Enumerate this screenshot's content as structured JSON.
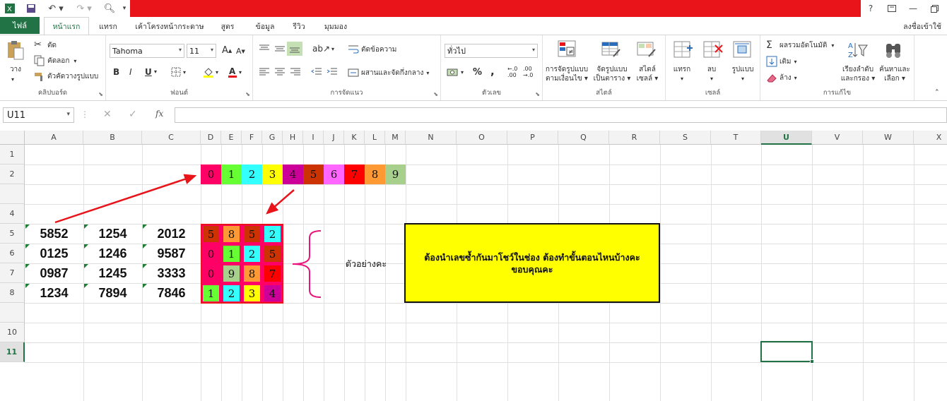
{
  "app": {
    "title": ""
  },
  "tabs": {
    "file": "ไฟล์",
    "items": [
      "หน้าแรก",
      "แทรก",
      "เค้าโครงหน้ากระดาษ",
      "สูตร",
      "ข้อมูล",
      "รีวิว",
      "มุมมอง"
    ],
    "active": "หน้าแรก",
    "signin": "ลงชื่อเข้าใช้"
  },
  "window_controls": {
    "help": "?"
  },
  "ribbon": {
    "clipboard": {
      "label": "คลิปบอร์ด",
      "paste": "วาง",
      "cut": "ตัด",
      "copy": "คัดลอก",
      "format_painter": "ตัวคัดวางรูปแบบ"
    },
    "font": {
      "label": "ฟอนต์",
      "font_name": "Tahoma",
      "font_size": "11",
      "bold": "B",
      "italic": "I",
      "underline": "U"
    },
    "alignment": {
      "label": "การจัดแนว",
      "wrap_text": "ตัดข้อความ",
      "merge_center": "ผสานและจัดกึ่งกลาง"
    },
    "number": {
      "label": "ตัวเลข",
      "format": "ทั่วไป",
      "percent": "%",
      "comma": ","
    },
    "styles": {
      "label": "สไตล์",
      "conditional_1": "การจัดรูปแบบ",
      "conditional_2": "ตามเงื่อนไข",
      "format_table_1": "จัดรูปแบบ",
      "format_table_2": "เป็นตาราง",
      "cell_styles_1": "สไตล์",
      "cell_styles_2": "เซลล์"
    },
    "cells": {
      "label": "เซลล์",
      "insert": "แทรก",
      "delete": "ลบ",
      "format": "รูปแบบ"
    },
    "editing": {
      "label": "การแก้ไข",
      "autosum": "ผลรวมอัตโนมัติ",
      "fill": "เติม",
      "clear": "ล้าง",
      "sort_1": "เรียงลำดับ",
      "sort_2": "และกรอง",
      "find_1": "ค้นหาและ",
      "find_2": "เลือก"
    }
  },
  "formula_bar": {
    "name_box": "U11",
    "fx": "fx",
    "value": ""
  },
  "sheet": {
    "columns": [
      "A",
      "B",
      "C",
      "D",
      "E",
      "F",
      "G",
      "H",
      "I",
      "J",
      "K",
      "L",
      "M",
      "N",
      "O",
      "P",
      "Q",
      "R",
      "S",
      "T",
      "U",
      "V",
      "W",
      "X"
    ],
    "rows": [
      "1",
      "2",
      "4",
      "5",
      "6",
      "7",
      "8",
      "10",
      "11"
    ],
    "selected_column": "U",
    "selected_row": "11",
    "digit_header": [
      "0",
      "1",
      "2",
      "3",
      "4",
      "5",
      "6",
      "7",
      "8",
      "9"
    ],
    "digit_header_colors": [
      "#ff0066",
      "#66ff33",
      "#33ffff",
      "#ffff00",
      "#cc0099",
      "#cc3300",
      "#ff66ff",
      "#ff0000",
      "#ff9933",
      "#a8d08d"
    ],
    "numbers": [
      [
        "5852",
        "1254",
        "2012"
      ],
      [
        "0125",
        "1246",
        "9587"
      ],
      [
        "0987",
        "1245",
        "3333"
      ],
      [
        "1234",
        "7894",
        "7846"
      ]
    ],
    "digit_block": [
      [
        "5",
        "8",
        "5",
        "2"
      ],
      [
        "0",
        "1",
        "2",
        "5"
      ],
      [
        "0",
        "9",
        "8",
        "7"
      ],
      [
        "1",
        "2",
        "3",
        "4"
      ]
    ],
    "digit_block_colors": [
      [
        "#cc3300",
        "#ff9933",
        "#cc3300",
        "#33ffff"
      ],
      [
        "#ff0066",
        "#66ff33",
        "#33ffff",
        "#cc3300"
      ],
      [
        "#ff0066",
        "#a8d08d",
        "#ff9933",
        "#ff0000"
      ],
      [
        "#66ff33",
        "#33ffff",
        "#ffff00",
        "#cc0099"
      ]
    ],
    "example_label": "ตัวอย่างคะ",
    "note": "ต้องนำเลขซ้ำกันมาโชว์ในช่อง ต้องทำขั้นตอนไหนบ้างคะ ขอบคุณคะ"
  },
  "colors": {
    "excel_green": "#217346",
    "title_red": "#e8141a",
    "note_bg": "#ffff00",
    "arrow": "#e8141a",
    "brace": "#e8147a"
  }
}
